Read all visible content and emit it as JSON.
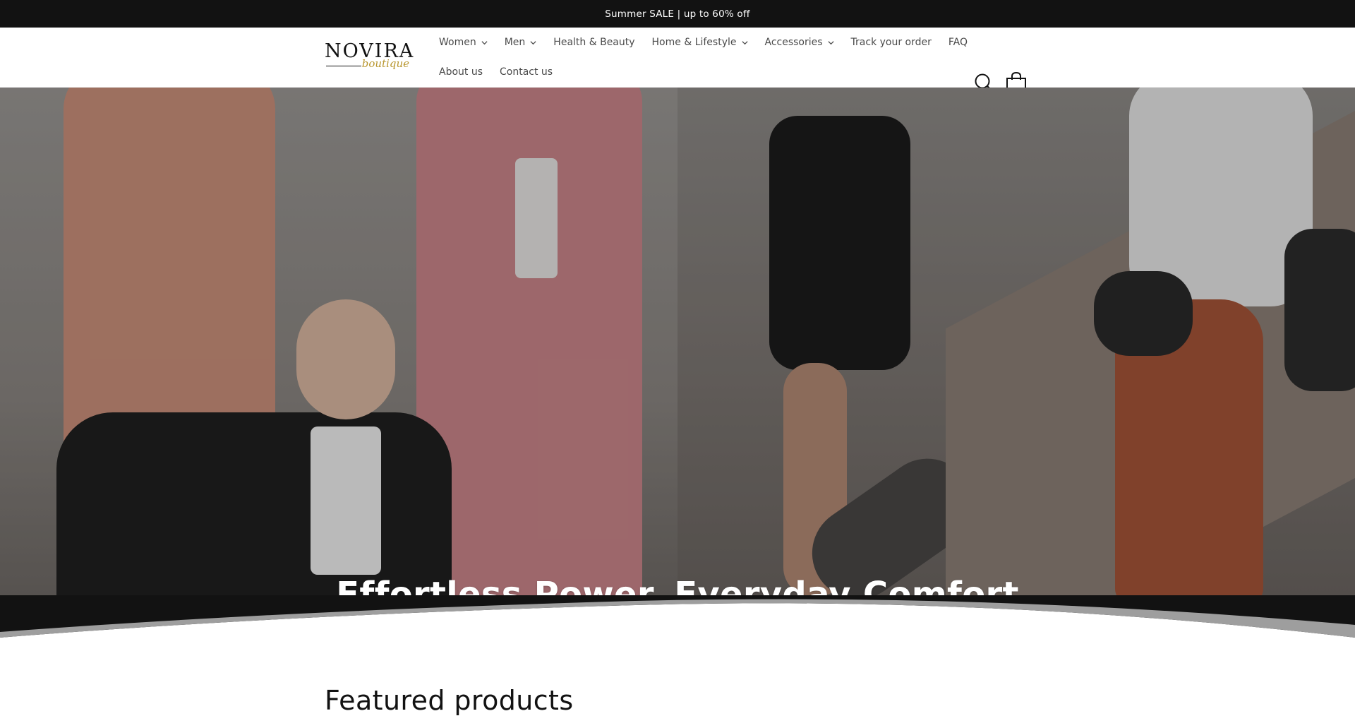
{
  "announcement": {
    "text": "Summer SALE | up to 60% off"
  },
  "brand": {
    "name": "NOVIRA",
    "tagline": "boutique"
  },
  "nav": {
    "row1": [
      {
        "label": "Women",
        "dropdown": true
      },
      {
        "label": "Men",
        "dropdown": true
      },
      {
        "label": "Health & Beauty",
        "dropdown": false
      },
      {
        "label": "Home & Lifestyle",
        "dropdown": true
      },
      {
        "label": "Accessories",
        "dropdown": true
      },
      {
        "label": "Track your order",
        "dropdown": false
      },
      {
        "label": "FAQ",
        "dropdown": false
      }
    ],
    "row2": [
      {
        "label": "About us",
        "dropdown": false
      },
      {
        "label": "Contact us",
        "dropdown": false
      }
    ]
  },
  "header_icons": {
    "search": "search-icon",
    "cart": "cart-icon"
  },
  "hero": {
    "headline": "Effortless Power, Everyday Comfort"
  },
  "featured": {
    "title": "Featured products"
  },
  "colors": {
    "announcement_bg": "#121212",
    "band_bg": "#121212",
    "accent_gold": "#b8962e"
  }
}
